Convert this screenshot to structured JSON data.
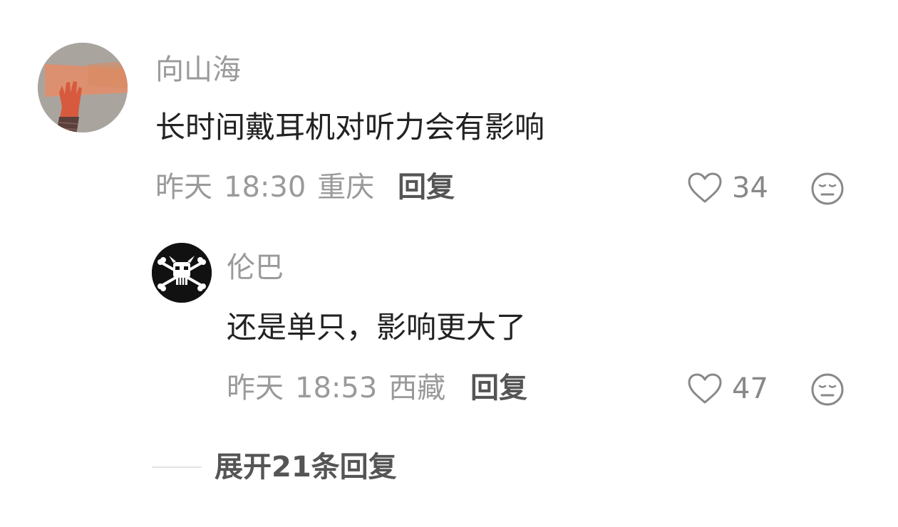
{
  "comment": {
    "username": "向山海",
    "text": "长时间戴耳机对听力会有影响",
    "date": "昨天",
    "time": "18:30",
    "location": "重庆",
    "reply_label": "回复",
    "likes": "34",
    "avatar_icon": "hand-photo"
  },
  "reply": {
    "username": "伦巴",
    "text": "还是单只，影响更大了",
    "date": "昨天",
    "time": "18:53",
    "location": "西藏",
    "reply_label": "回复",
    "likes": "47",
    "avatar_icon": "skull-crossbones"
  },
  "expand": {
    "label": "展开21条回复"
  },
  "icons": {
    "like": "heart-outline-icon",
    "dislike": "neutral-face-icon"
  },
  "colors": {
    "secondary_text": "#9a9a9a",
    "primary_text": "#222222",
    "action_text": "#555555"
  }
}
